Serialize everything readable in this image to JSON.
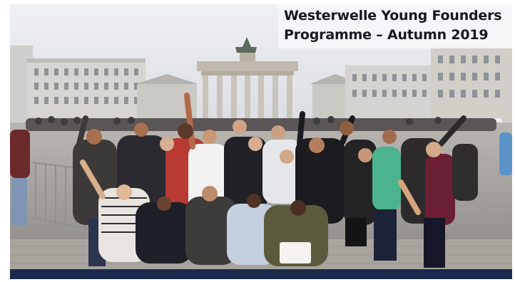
{
  "banner": {
    "title_line1": "Westerwelle Young Founders",
    "title_line2": "Programme – Autumn 2019"
  },
  "photo": {
    "alt": "Group photo in front of the Brandenburg Gate"
  },
  "colors": {
    "band": "#1b2a4c",
    "title_box": "#f4f6f8",
    "title_text": "#16181d"
  }
}
